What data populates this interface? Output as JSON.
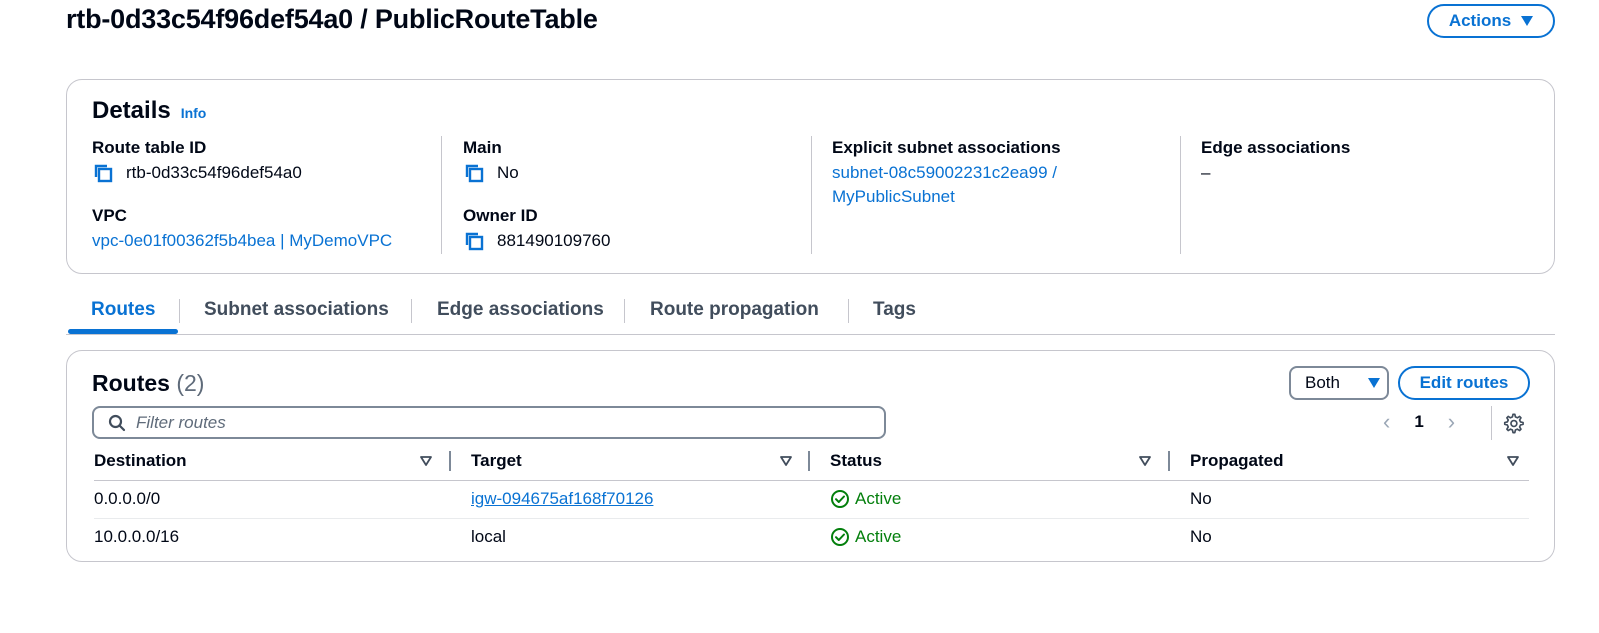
{
  "header": {
    "title": "rtb-0d33c54f96def54a0 / PublicRouteTable",
    "actions_label": "Actions"
  },
  "details": {
    "title": "Details",
    "info_label": "Info",
    "route_table_id_label": "Route table ID",
    "route_table_id": "rtb-0d33c54f96def54a0",
    "vpc_label": "VPC",
    "vpc_value": "vpc-0e01f00362f5b4bea | MyDemoVPC",
    "main_label": "Main",
    "main_value": "No",
    "owner_id_label": "Owner ID",
    "owner_id": "881490109760",
    "explicit_subnet_label": "Explicit subnet associations",
    "explicit_subnet_line1": "subnet-08c59002231c2ea99 /",
    "explicit_subnet_line2": "MyPublicSubnet",
    "edge_assoc_label": "Edge associations",
    "edge_assoc_value": "–"
  },
  "tabs": [
    {
      "label": "Routes"
    },
    {
      "label": "Subnet associations"
    },
    {
      "label": "Edge associations"
    },
    {
      "label": "Route propagation"
    },
    {
      "label": "Tags"
    }
  ],
  "routes": {
    "title": "Routes",
    "count": "(2)",
    "filter_selected": "Both",
    "edit_label": "Edit routes",
    "search_placeholder": "Filter routes",
    "page": "1",
    "columns": [
      "Destination",
      "Target",
      "Status",
      "Propagated"
    ],
    "rows": [
      {
        "destination": "0.0.0.0/0",
        "target": "igw-094675af168f70126",
        "status": "Active",
        "propagated": "No"
      },
      {
        "destination": "10.0.0.0/16",
        "target": "local",
        "status": "Active",
        "propagated": "No"
      }
    ]
  },
  "colors": {
    "accent": "#0972d3",
    "success": "#037f0c",
    "border": "#c6c6cd"
  },
  "icons": [
    "copy-icon",
    "caret-down-icon",
    "search-icon",
    "chevron-left-icon",
    "chevron-right-icon",
    "gear-icon",
    "sort-icon",
    "status-success-icon"
  ]
}
